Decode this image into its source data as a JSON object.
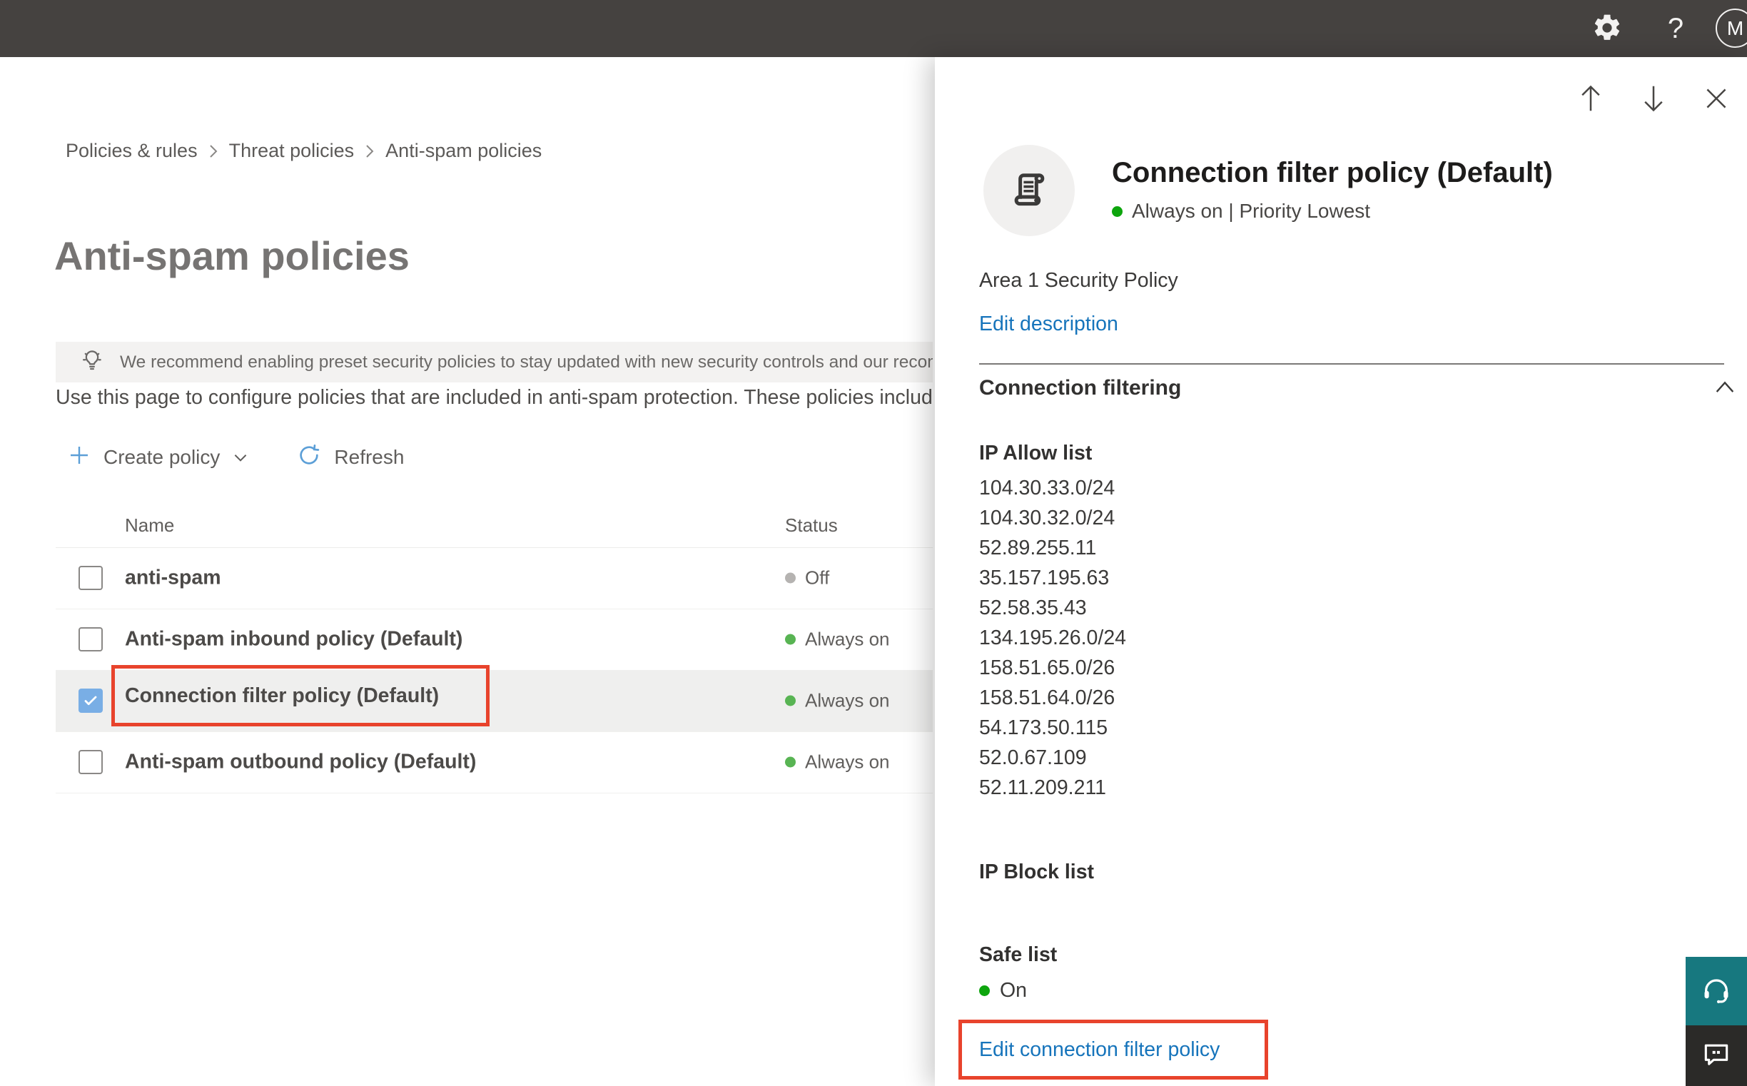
{
  "topbar": {
    "help_label": "?",
    "avatar_initial": "M"
  },
  "breadcrumb": {
    "items": [
      "Policies & rules",
      "Threat policies",
      "Anti-spam policies"
    ]
  },
  "page": {
    "title": "Anti-spam policies",
    "banner_text": "We recommend enabling preset security policies to stay updated with new security controls and our recomme",
    "description": "Use this page to configure policies that are included in anti-spam protection. These policies include"
  },
  "toolbar": {
    "create_label": "Create policy",
    "refresh_label": "Refresh"
  },
  "table": {
    "columns": [
      "Name",
      "Status"
    ],
    "rows": [
      {
        "name": "anti-spam",
        "status": "Off"
      },
      {
        "name": "Anti-spam inbound policy (Default)",
        "status": "Always on"
      },
      {
        "name": "Connection filter policy (Default)",
        "status": "Always on"
      },
      {
        "name": "Anti-spam outbound policy (Default)",
        "status": "Always on"
      }
    ]
  },
  "panel": {
    "title": "Connection filter policy (Default)",
    "status_line": "Always on | Priority Lowest",
    "description": "Area 1 Security Policy",
    "edit_description_label": "Edit description",
    "section_title": "Connection filtering",
    "ip_allow_label": "IP Allow list",
    "ip_allow": [
      "104.30.33.0/24",
      "104.30.32.0/24",
      "52.89.255.11",
      "35.157.195.63",
      "52.58.35.43",
      "134.195.26.0/24",
      "158.51.65.0/26",
      "158.51.64.0/26",
      "54.173.50.115",
      "52.0.67.109",
      "52.11.209.211"
    ],
    "ip_block_label": "IP Block list",
    "safe_list_label": "Safe list",
    "safe_list_status": "On",
    "edit_link_label": "Edit connection filter policy"
  },
  "colors": {
    "topbar": "#454240",
    "accent_blue": "#1674bb",
    "icon_blue": "#5c9fd7",
    "annotation_red": "#e8432c",
    "status_green": "#58b453",
    "status_green_bright": "#0da50d",
    "status_gray": "#b5b3b1",
    "checkbox_blue": "#79aee5",
    "support_teal": "#17787f",
    "feedback_dark": "#2b2a28"
  }
}
